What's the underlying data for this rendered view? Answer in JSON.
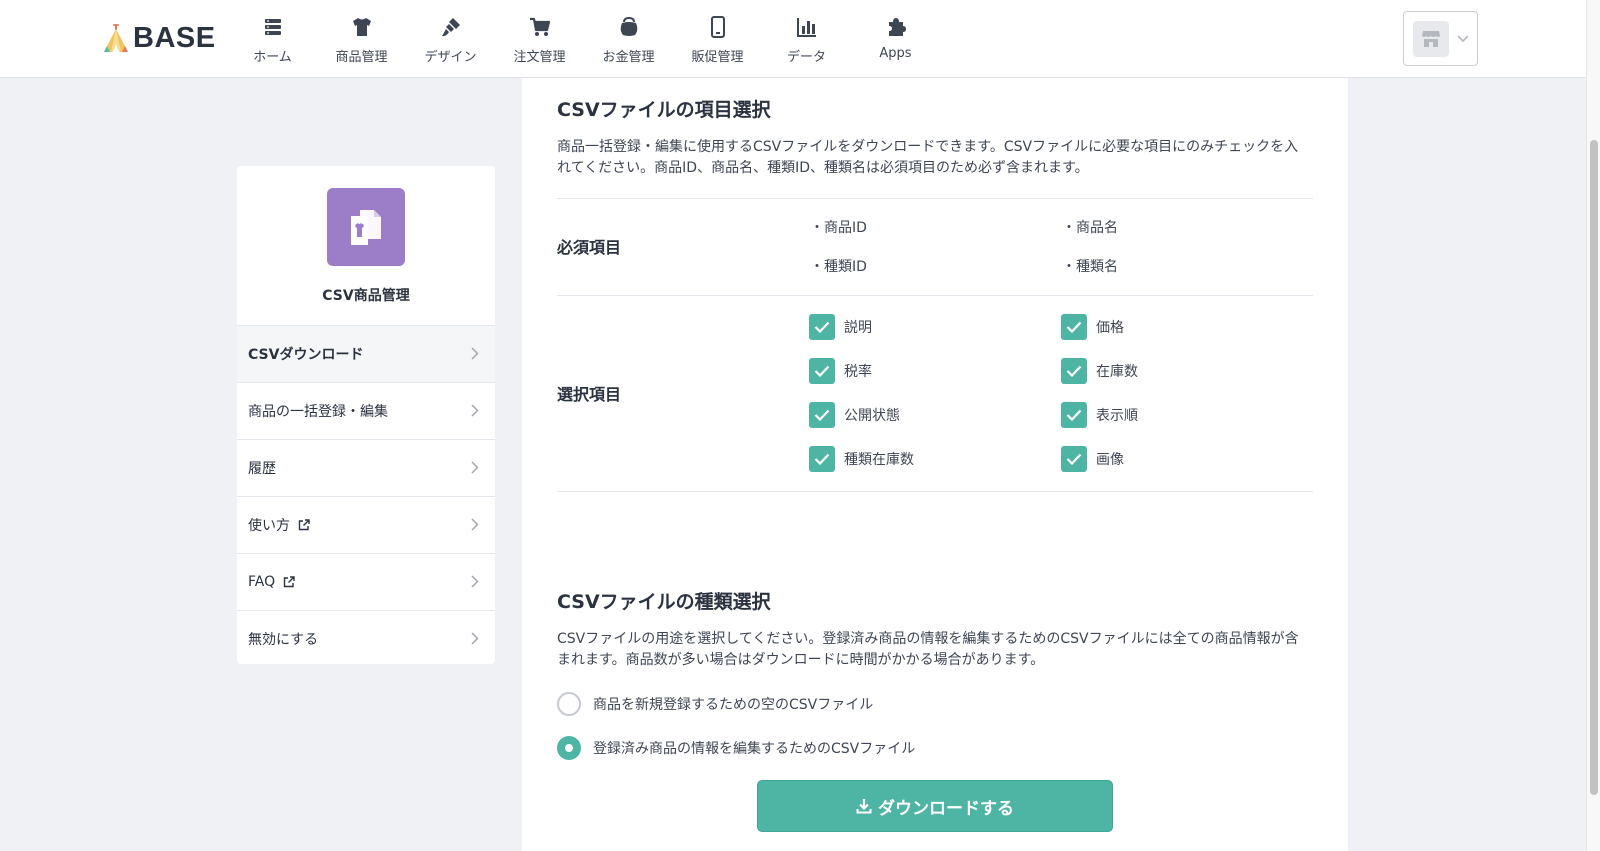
{
  "header": {
    "logo_text": "BASE",
    "nav": [
      {
        "label": "ホーム",
        "icon": "home-icon"
      },
      {
        "label": "商品管理",
        "icon": "shirt-icon"
      },
      {
        "label": "デザイン",
        "icon": "brush-icon"
      },
      {
        "label": "注文管理",
        "icon": "cart-icon"
      },
      {
        "label": "お金管理",
        "icon": "wallet-icon"
      },
      {
        "label": "販促管理",
        "icon": "phone-icon"
      },
      {
        "label": "データ",
        "icon": "bar-chart-icon"
      },
      {
        "label": "Apps",
        "icon": "puzzle-icon"
      }
    ],
    "shop_icon": "shop-icon"
  },
  "sidebar": {
    "app_title": "CSV商品管理",
    "items": [
      {
        "label": "CSVダウンロード",
        "active": true
      },
      {
        "label": "商品の一括登録・編集"
      },
      {
        "label": "履歴"
      },
      {
        "label": "使い方",
        "external": true
      },
      {
        "label": "FAQ",
        "external": true
      },
      {
        "label": "無効にする"
      }
    ]
  },
  "main": {
    "fields_section": {
      "title": "CSVファイルの項目選択",
      "description": "商品一括登録・編集に使用するCSVファイルをダウンロードできます。CSVファイルに必要な項目にのみチェックを入れてください。商品ID、商品名、種類ID、種類名は必須項目のため必ず含まれます。",
      "required_label": "必須項目",
      "required_items": [
        "・商品ID",
        "・商品名",
        "・種類ID",
        "・種類名"
      ],
      "optional_label": "選択項目",
      "optional_items": [
        {
          "label": "説明",
          "checked": true
        },
        {
          "label": "価格",
          "checked": true
        },
        {
          "label": "税率",
          "checked": true
        },
        {
          "label": "在庫数",
          "checked": true
        },
        {
          "label": "公開状態",
          "checked": true
        },
        {
          "label": "表示順",
          "checked": true
        },
        {
          "label": "種類在庫数",
          "checked": true
        },
        {
          "label": "画像",
          "checked": true
        }
      ]
    },
    "type_section": {
      "title": "CSVファイルの種類選択",
      "description": "CSVファイルの用途を選択してください。登録済み商品の情報を編集するためのCSVファイルには全ての商品情報が含まれます。商品数が多い場合はダウンロードに時間がかかる場合があります。",
      "options": [
        {
          "label": "商品を新規登録するための空のCSVファイル",
          "selected": false
        },
        {
          "label": "登録済み商品の情報を編集するためのCSVファイル",
          "selected": true
        }
      ]
    },
    "download_button": "ダウンロードする"
  },
  "colors": {
    "accent": "#4eb5a5",
    "app_icon": "#9b7dc8",
    "background": "#f0f1f4"
  }
}
